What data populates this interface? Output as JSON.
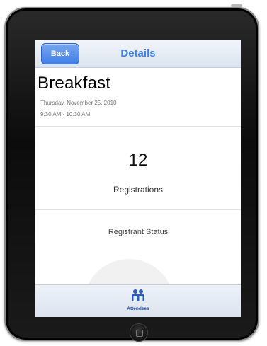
{
  "navbar": {
    "back_label": "Back",
    "title": "Details"
  },
  "event": {
    "title": "Breakfast",
    "date": "Thursday, November 25, 2010",
    "time": "9:30 AM - 10:30 AM"
  },
  "stats": {
    "registrations_count": "12",
    "registrations_label": "Registrations"
  },
  "status": {
    "label": "Registrant Status"
  },
  "tabbar": {
    "tabs": [
      {
        "label": "Attendees",
        "icon": "attendees-icon"
      }
    ]
  },
  "colors": {
    "accent": "#3f7fe6",
    "navbar_bg": "#dbe4f0",
    "tab_label": "#1a4a9c"
  }
}
